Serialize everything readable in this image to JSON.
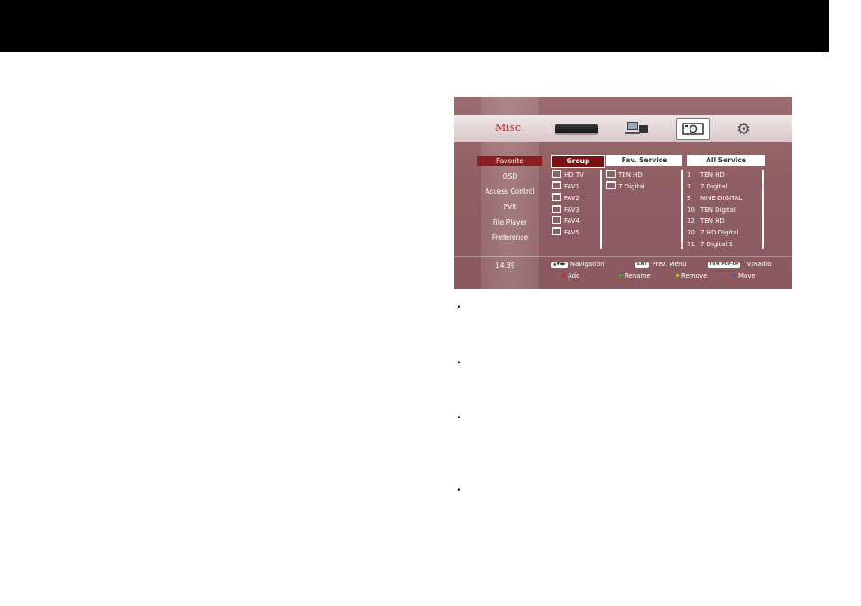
{
  "menu": {
    "header": "Misc.",
    "items": [
      "Favorite",
      "OSD",
      "Access Control",
      "PVR",
      "File Player",
      "Preference"
    ],
    "selected_index": 0
  },
  "icons": [
    "set-top-box-icon",
    "network-pc-icon",
    "media-icon",
    "settings-gear-icon"
  ],
  "columns": {
    "group_label": "Group",
    "fav_label": "Fav. Service",
    "all_label": "All Service"
  },
  "groups": [
    "HD TV",
    "FAV1",
    "FAV2",
    "FAV3",
    "FAV4",
    "FAV5"
  ],
  "fav_services": [
    "TEN HD",
    "7 Digital"
  ],
  "all_services": [
    {
      "num": "1",
      "name": "TEN HD"
    },
    {
      "num": "7",
      "name": "7 Digital"
    },
    {
      "num": "9",
      "name": "NINE DIGITAL"
    },
    {
      "num": "10",
      "name": "TEN Digital"
    },
    {
      "num": "12",
      "name": "TEN HD"
    },
    {
      "num": "70",
      "name": "7 HD Digital"
    },
    {
      "num": "71",
      "name": "7 Digital 1"
    }
  ],
  "clock": "14:39",
  "hints": {
    "navigation_key": "▲▼◀▶",
    "navigation": "Navigation",
    "exit_key": "EXIT",
    "prev_menu": "Prev. Menu",
    "tvradio_key": "TV/R  POP-UP",
    "tvradio": "TV/Radio",
    "add": "Add",
    "rename": "Rename",
    "remove": "Remove",
    "move": "Move"
  },
  "colors": {
    "red": "#e02020",
    "green": "#20c020",
    "yellow": "#e0c020",
    "blue": "#3050e0"
  },
  "bullets": [
    "•",
    "•",
    "•",
    "•"
  ]
}
